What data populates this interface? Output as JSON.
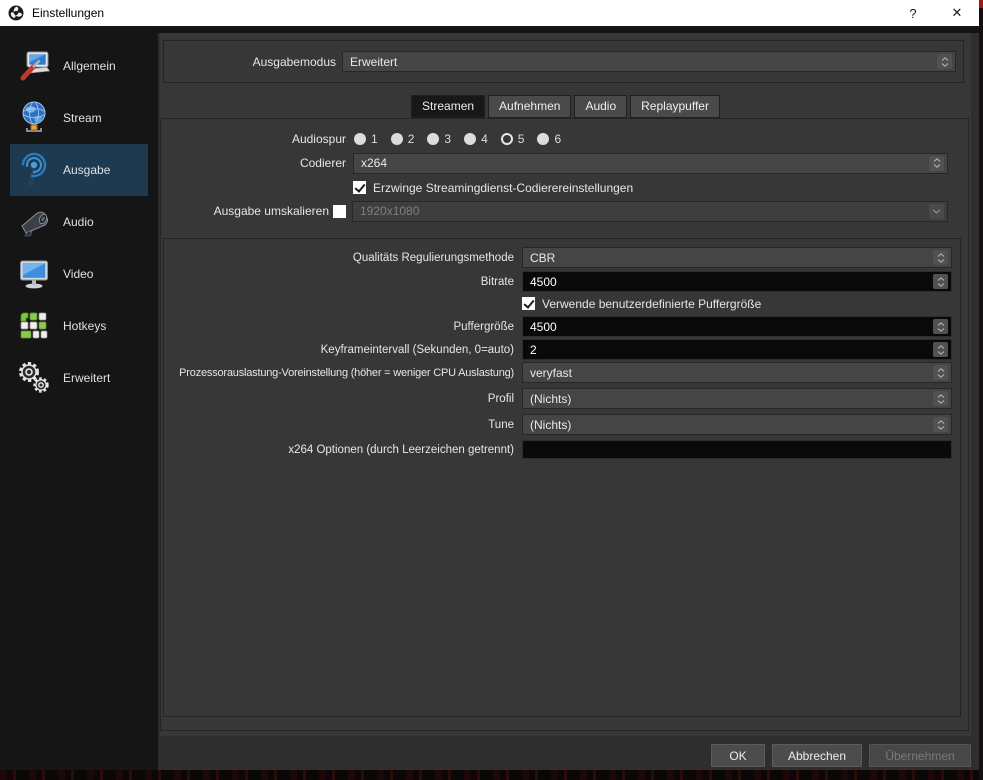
{
  "window": {
    "title": "Einstellungen",
    "help_label": "?",
    "close_label": "✕",
    "icon": "obs-logo-icon"
  },
  "colors": {
    "titlebar_bg": "#ffffff",
    "sidebar_bg": "#151515",
    "sidebar_selected_bg": "#1d3a50",
    "panel_bg": "#373737",
    "field_dark_bg": "#090909",
    "combo_bg": "#454545"
  },
  "sidebar": {
    "items": [
      {
        "label": "Allgemein",
        "icon": "general-icon",
        "selected": false
      },
      {
        "label": "Stream",
        "icon": "stream-icon",
        "selected": false
      },
      {
        "label": "Ausgabe",
        "icon": "output-icon",
        "selected": true
      },
      {
        "label": "Audio",
        "icon": "audio-icon",
        "selected": false
      },
      {
        "label": "Video",
        "icon": "video-icon",
        "selected": false
      },
      {
        "label": "Hotkeys",
        "icon": "hotkeys-icon",
        "selected": false
      },
      {
        "label": "Erweitert",
        "icon": "advanced-icon",
        "selected": false
      }
    ]
  },
  "output_mode": {
    "label": "Ausgabemodus",
    "value": "Erweitert"
  },
  "tabs": [
    {
      "label": "Streamen",
      "selected": true
    },
    {
      "label": "Aufnehmen",
      "selected": false
    },
    {
      "label": "Audio",
      "selected": false
    },
    {
      "label": "Replaypuffer",
      "selected": false
    }
  ],
  "streaming_tab": {
    "audio_track": {
      "label": "Audiospur",
      "options": [
        "1",
        "2",
        "3",
        "4",
        "5",
        "6"
      ],
      "selected": "5"
    },
    "encoder": {
      "label": "Codierer",
      "value": "x264"
    },
    "enforce_checkbox": {
      "label": "Erzwinge Streamingdienst-Codierereinstellungen",
      "checked": true
    },
    "rescale": {
      "label": "Ausgabe umskalieren",
      "checked": false,
      "value": "1920x1080",
      "disabled": true
    },
    "encoder_settings": {
      "rate_control": {
        "label": "Qualitäts Regulierungsmethode",
        "value": "CBR"
      },
      "bitrate": {
        "label": "Bitrate",
        "value": "4500"
      },
      "custom_buffer_checkbox": {
        "label": "Verwende benutzerdefinierte Puffergröße",
        "checked": true
      },
      "buffer_size": {
        "label": "Puffergröße",
        "value": "4500"
      },
      "keyframe_interval": {
        "label": "Keyframeintervall (Sekunden, 0=auto)",
        "value": "2"
      },
      "cpu_preset": {
        "label": "Prozessorauslastung-Voreinstellung (höher = weniger CPU Auslastung)",
        "value": "veryfast"
      },
      "profile": {
        "label": "Profil",
        "value": "(Nichts)"
      },
      "tune": {
        "label": "Tune",
        "value": "(Nichts)"
      },
      "x264_options": {
        "label": "x264 Optionen (durch Leerzeichen getrennt)",
        "value": ""
      }
    }
  },
  "footer": {
    "ok": "OK",
    "cancel": "Abbrechen",
    "apply": "Übernehmen"
  }
}
